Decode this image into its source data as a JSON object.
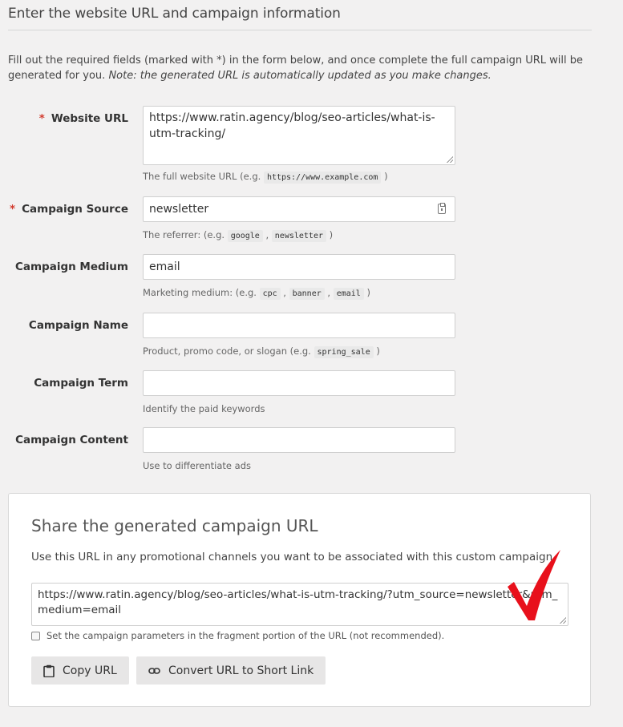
{
  "header": {
    "title": "Enter the website URL and campaign information"
  },
  "intro": {
    "text": "Fill out the required fields (marked with *) in the form below, and once complete the full campaign URL will be generated for you.",
    "note": "Note: the generated URL is automatically updated as you make changes."
  },
  "form": {
    "required_marker": "*",
    "fields": [
      {
        "label": "Website URL",
        "required": true,
        "value": "https://www.ratin.agency/blog/seo-articles/what-is-utm-tracking/",
        "help_prefix": "The full website URL (e.g.",
        "help_codes": [
          "https://www.example.com"
        ],
        "help_suffix": ")"
      },
      {
        "label": "Campaign Source",
        "required": true,
        "value": "newsletter",
        "help_prefix": "The referrer: (e.g.",
        "help_codes": [
          "google",
          "newsletter"
        ],
        "help_suffix": ")"
      },
      {
        "label": "Campaign Medium",
        "required": false,
        "value": "email",
        "help_prefix": "Marketing medium: (e.g.",
        "help_codes": [
          "cpc",
          "banner",
          "email"
        ],
        "help_suffix": ")"
      },
      {
        "label": "Campaign Name",
        "required": false,
        "value": "",
        "help_prefix": "Product, promo code, or slogan (e.g.",
        "help_codes": [
          "spring_sale"
        ],
        "help_suffix": ")"
      },
      {
        "label": "Campaign Term",
        "required": false,
        "value": "",
        "help_prefix": "Identify the paid keywords"
      },
      {
        "label": "Campaign Content",
        "required": false,
        "value": "",
        "help_prefix": "Use to differentiate ads"
      }
    ]
  },
  "share": {
    "title": "Share the generated campaign URL",
    "description": "Use this URL in any promotional channels you want to be associated with this custom campaign",
    "url": "https://www.ratin.agency/blog/seo-articles/what-is-utm-tracking/?utm_source=newsletter&utm_medium=email",
    "fragment_label": "Set the campaign parameters in the fragment portion of the URL (not recommended).",
    "fragment_checked": false,
    "copy_button": "Copy URL",
    "shortlink_button": "Convert URL to Short Link",
    "accent_color": "#e8101b"
  },
  "icons": {
    "clipboard": "clipboard-icon",
    "link": "link-icon",
    "checkmark": "checkmark-icon"
  }
}
